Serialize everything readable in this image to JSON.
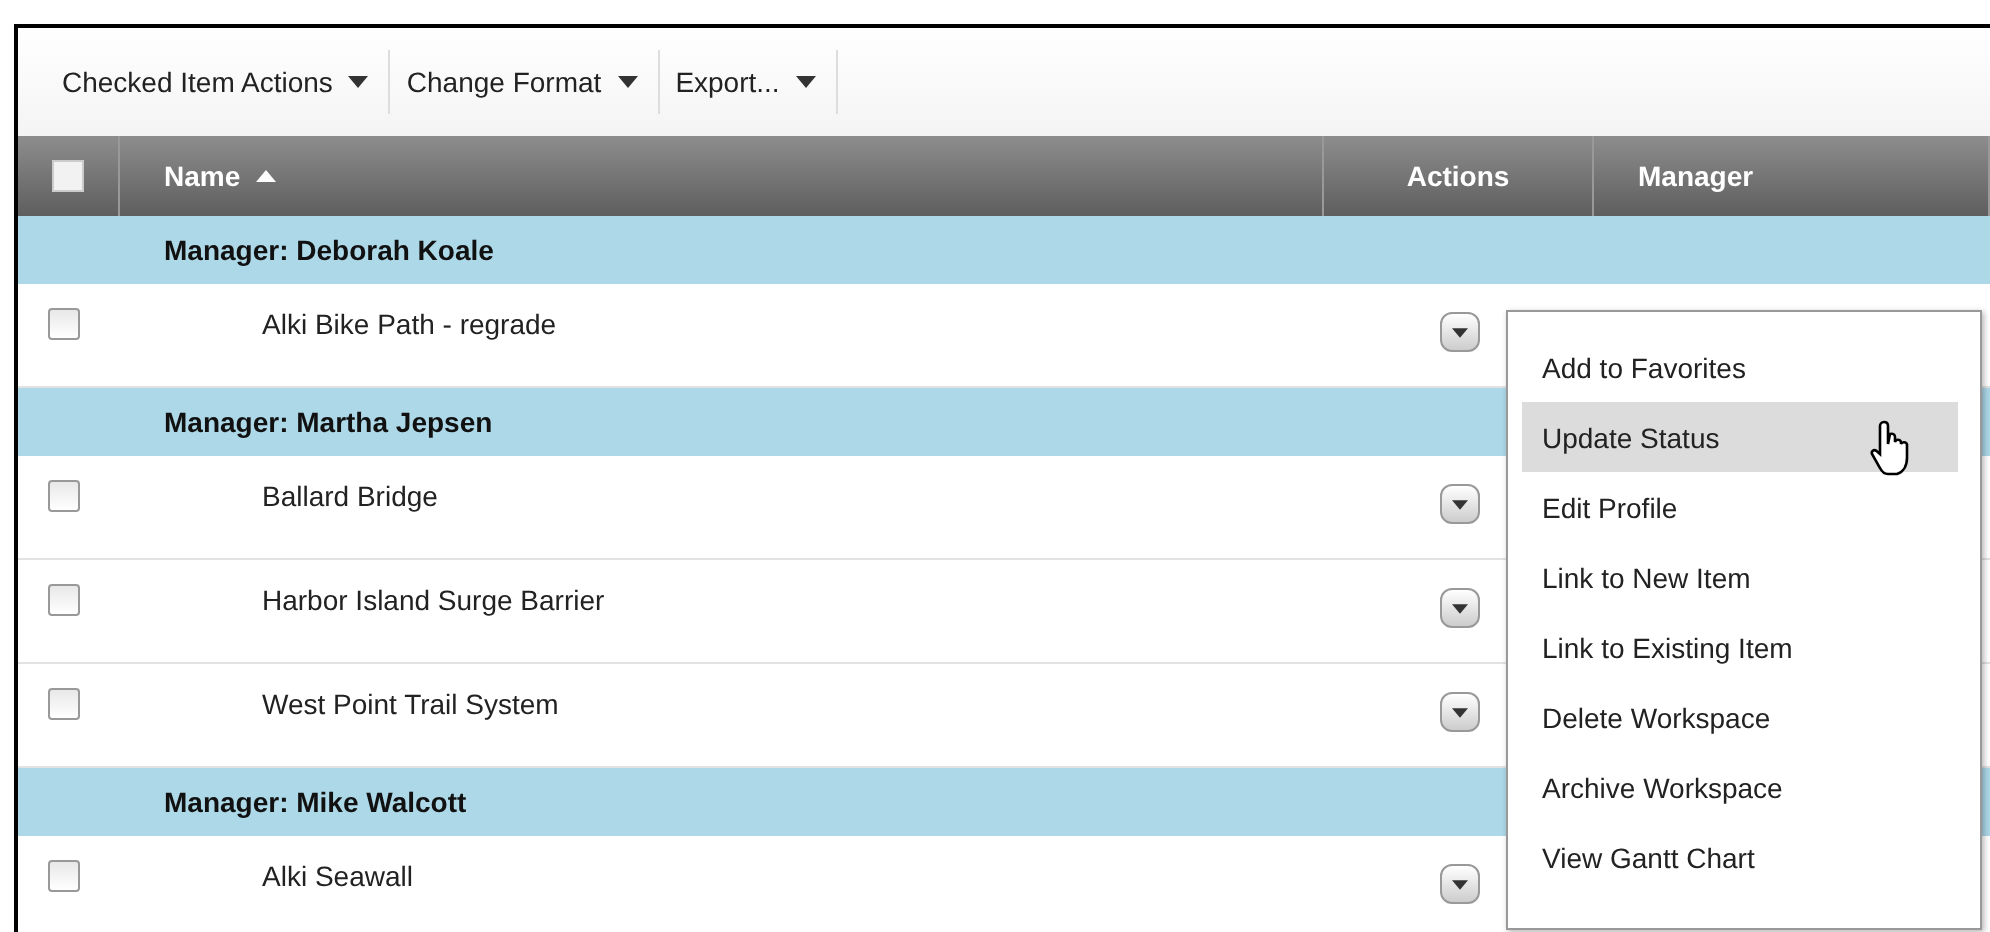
{
  "toolbar": [
    {
      "label": "Checked Item Actions"
    },
    {
      "label": "Change Format"
    },
    {
      "label": "Export..."
    }
  ],
  "table": {
    "select_all": {
      "checked": false
    },
    "columns": [
      {
        "label": "Name",
        "sorted": true
      },
      {
        "label": "Actions",
        "sorted": false
      },
      {
        "label": "Manager",
        "sorted": false
      }
    ],
    "groups": [
      {
        "label": "Manager: Deborah Koale",
        "rows": [
          {
            "name": "Alki Bike Path - regrade",
            "checked": false
          }
        ]
      },
      {
        "label": "Manager: Martha Jepsen",
        "rows": [
          {
            "name": "Ballard Bridge",
            "checked": false
          },
          {
            "name": "Harbor Island Surge Barrier",
            "checked": false
          },
          {
            "name": "West Point Trail System",
            "checked": false
          }
        ]
      },
      {
        "label": "Manager: Mike Walcott",
        "rows": [
          {
            "name": "Alki Seawall",
            "checked": false
          }
        ]
      }
    ]
  },
  "context_menu": {
    "items": [
      {
        "label": "Add to Favorites",
        "selected": false
      },
      {
        "label": "Update Status",
        "selected": true
      },
      {
        "label": "Edit Profile",
        "selected": false
      },
      {
        "label": "Link to New Item",
        "selected": false
      },
      {
        "label": "Link to Existing Item",
        "selected": false
      },
      {
        "label": "Delete Workspace",
        "selected": false
      },
      {
        "label": "Archive Workspace",
        "selected": false
      },
      {
        "label": "View Gantt Chart",
        "selected": false
      }
    ]
  }
}
